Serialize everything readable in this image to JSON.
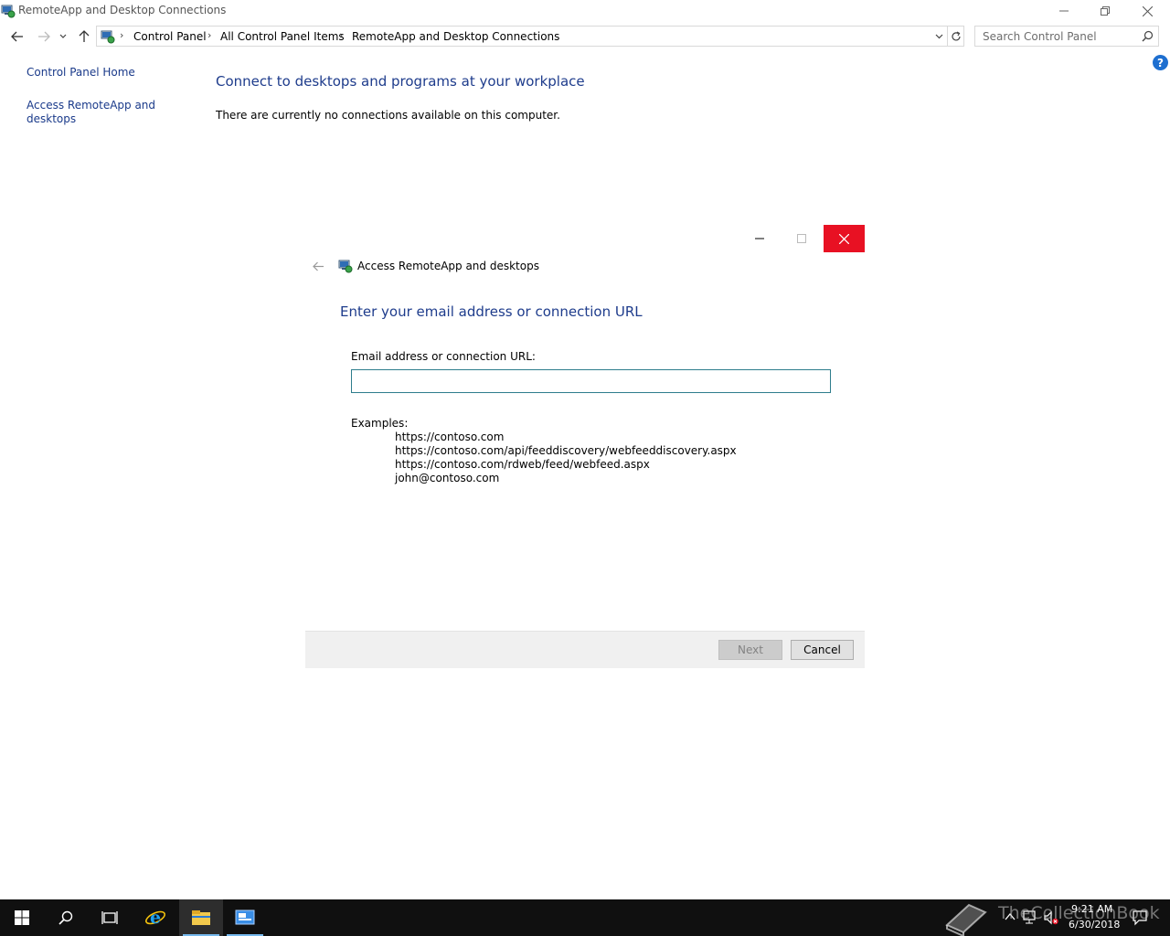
{
  "window": {
    "title": "RemoteApp and Desktop Connections"
  },
  "addressbar": {
    "crumbs": [
      "Control Panel",
      "All Control Panel Items",
      "RemoteApp and Desktop Connections"
    ]
  },
  "search": {
    "placeholder": "Search Control Panel"
  },
  "leftpane": {
    "home_link": "Control Panel Home",
    "access_link_line1": "Access RemoteApp and",
    "access_link_line2": "desktops"
  },
  "main": {
    "title": "Connect to desktops and programs at your workplace",
    "message": "There are currently no connections available on this computer."
  },
  "dialog": {
    "title": "Access RemoteApp and desktops",
    "heading": "Enter your email address or connection URL",
    "field_label": "Email address or connection URL:",
    "field_value": "",
    "examples_label": "Examples:",
    "examples": [
      "https://contoso.com",
      "https://contoso.com/api/feeddiscovery/webfeeddiscovery.aspx",
      "https://contoso.com/rdweb/feed/webfeed.aspx",
      "john@contoso.com"
    ],
    "next_label": "Next",
    "cancel_label": "Cancel"
  },
  "taskbar": {
    "time": "9:21 AM",
    "date": "6/30/2018",
    "watermark": "TheCollectionBook"
  },
  "colors": {
    "heading_blue": "#1e3c8c",
    "link_blue": "#1a3a8a",
    "close_red": "#e81123",
    "taskbar": "#101010"
  }
}
